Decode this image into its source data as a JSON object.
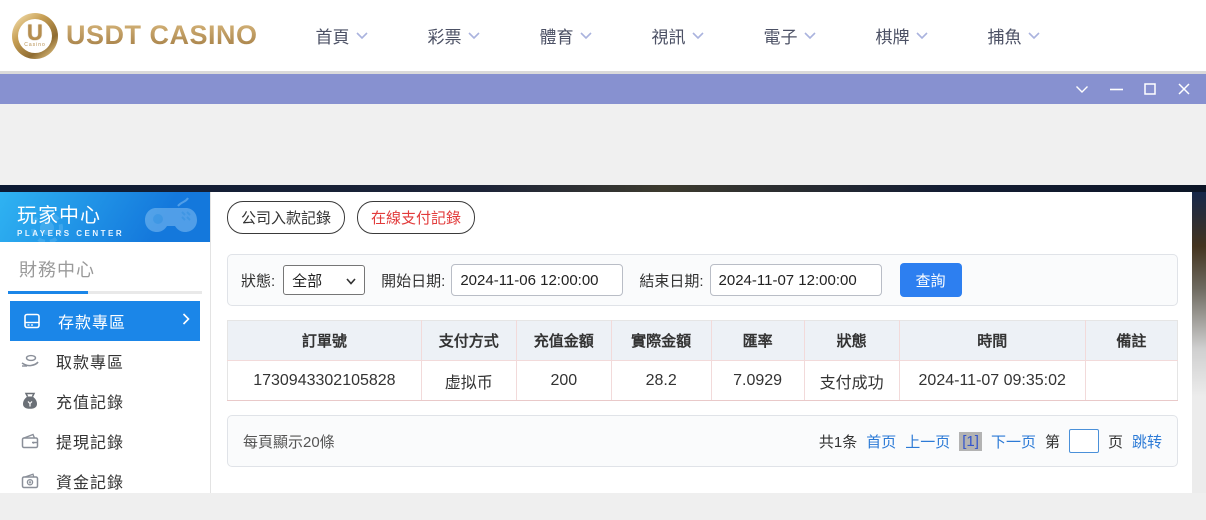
{
  "colors": {
    "titlebar_purple": "#8791d0",
    "sidebar_blue_start": "#2fb3f2",
    "sidebar_blue_end": "#1478dc",
    "active_item_blue": "#1b86e8",
    "search_button_blue": "#2d7ff0",
    "link_blue": "#2c7ad6",
    "tab_red": "#e23b3b",
    "table_header_bg": "#edf1f6",
    "table_border_pink": "#f2dada",
    "logo_gold": "#bb9257"
  },
  "header": {
    "logo": {
      "monogram": "U",
      "small_text": "Casino",
      "brand": "USDT CASINO"
    },
    "nav": {
      "items": [
        {
          "label": "首頁"
        },
        {
          "label": "彩票"
        },
        {
          "label": "體育"
        },
        {
          "label": "視訊"
        },
        {
          "label": "電子"
        },
        {
          "label": "棋牌"
        },
        {
          "label": "捕魚"
        }
      ]
    }
  },
  "titlebar": {
    "controls": [
      {
        "icon": "chevron-down-icon"
      },
      {
        "icon": "minimize-icon"
      },
      {
        "icon": "maximize-icon"
      },
      {
        "icon": "close-icon"
      }
    ]
  },
  "sidebar": {
    "title": "玩家中心",
    "subtitle": "PLAYERS CENTER",
    "section_title": "財務中心",
    "items": [
      {
        "label": "存款專區",
        "icon": "deposit-machine-icon",
        "active": true
      },
      {
        "label": "取款專區",
        "icon": "hand-coins-icon",
        "active": false
      },
      {
        "label": "充值記錄",
        "icon": "money-bag-icon",
        "active": false
      },
      {
        "label": "提現記錄",
        "icon": "wallet-icon",
        "active": false
      },
      {
        "label": "資金記錄",
        "icon": "coins-icon",
        "active": false
      }
    ]
  },
  "main": {
    "tabs": [
      {
        "label": "公司入款記錄"
      },
      {
        "label": "在線支付記錄"
      }
    ],
    "filters": {
      "status_label": "狀態:",
      "status_value": "全部",
      "start_label": "開始日期:",
      "start_value": "2024-11-06 12:00:00",
      "end_label": "結束日期:",
      "end_value": "2024-11-07 12:00:00",
      "search_button": "查詢"
    },
    "table": {
      "headers": [
        "訂單號",
        "支付方式",
        "充值金額",
        "實際金額",
        "匯率",
        "狀態",
        "時間",
        "備註"
      ],
      "rows": [
        [
          "1730943302105828",
          "虚拟币",
          "200",
          "28.2",
          "7.0929",
          "支付成功",
          "2024-11-07 09:35:02",
          ""
        ]
      ]
    },
    "pagination": {
      "page_size_text": "每頁顯示20條",
      "total_text": "共1条",
      "first_label": "首页",
      "prev_label": "上一页",
      "current_page": "[1]",
      "next_label": "下一页",
      "jump_prefix": "第",
      "jump_suffix": "页",
      "jump_label": "跳转",
      "page_input_value": ""
    }
  }
}
